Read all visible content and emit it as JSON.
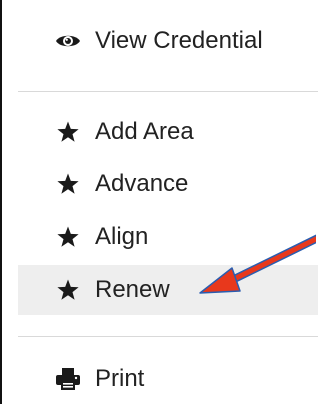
{
  "menu": {
    "items": [
      {
        "label": "View Credential",
        "icon": "eye-icon"
      },
      {
        "label": "Add Area",
        "icon": "star-icon"
      },
      {
        "label": "Advance",
        "icon": "star-icon"
      },
      {
        "label": "Align",
        "icon": "star-icon"
      },
      {
        "label": "Renew",
        "icon": "star-icon"
      },
      {
        "label": "Print",
        "icon": "printer-icon"
      }
    ],
    "highlighted": "Renew"
  },
  "colors": {
    "highlight_bg": "#eeeeee",
    "divider": "#d9d9d9",
    "arrow": "#e8381c",
    "arrow_outline": "#2a5db0"
  }
}
